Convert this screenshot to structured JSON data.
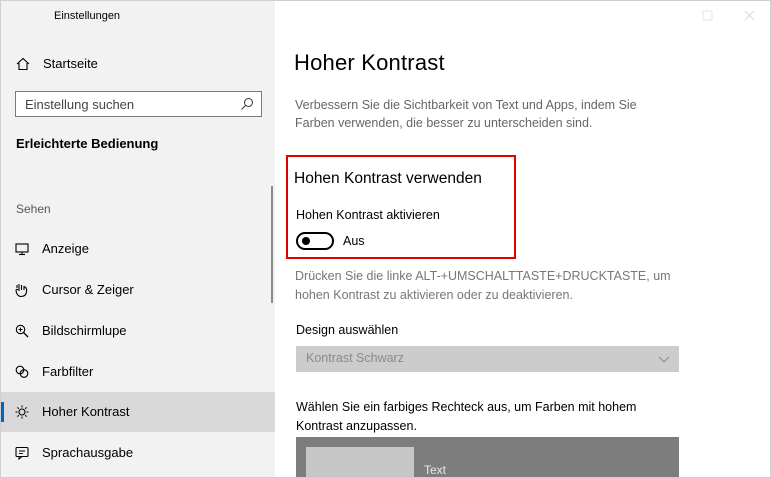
{
  "window": {
    "title": "Einstellungen"
  },
  "sidebar": {
    "home_label": "Startseite",
    "search_placeholder": "Einstellung suchen",
    "section_heading": "Erleichterte Bedienung",
    "group_label": "Sehen",
    "items": [
      {
        "label": "Anzeige",
        "icon": "monitor-icon"
      },
      {
        "label": "Cursor & Zeiger",
        "icon": "cursor-icon"
      },
      {
        "label": "Bildschirmlupe",
        "icon": "magnifier-icon"
      },
      {
        "label": "Farbfilter",
        "icon": "color-filter-icon"
      },
      {
        "label": "Hoher Kontrast",
        "icon": "contrast-sun-icon",
        "selected": true
      },
      {
        "label": "Sprachausgabe",
        "icon": "narrator-icon"
      }
    ]
  },
  "main": {
    "title": "Hoher Kontrast",
    "description": "Verbessern Sie die Sichtbarkeit von Text und Apps, indem Sie Farben verwenden, die besser zu unterscheiden sind.",
    "section_heading": "Hohen Kontrast verwenden",
    "toggle_label": "Hohen Kontrast aktivieren",
    "toggle_state": "Aus",
    "toggle_on": false,
    "shortcut_hint": "Drücken Sie die linke ALT-+UMSCHALTTASTE+DRUCKTASTE, um hohen Kontrast zu aktivieren oder zu deaktivieren.",
    "design_label": "Design auswählen",
    "design_selected": "Kontrast Schwarz",
    "color_desc": "Wählen Sie ein farbiges Rechteck aus, um Farben mit hohem Kontrast anzupassen.",
    "preview_text": "Text"
  },
  "colors": {
    "accent": "#0067c0",
    "highlight_border": "#e00000",
    "sidebar_bg": "#f2f2f2"
  }
}
